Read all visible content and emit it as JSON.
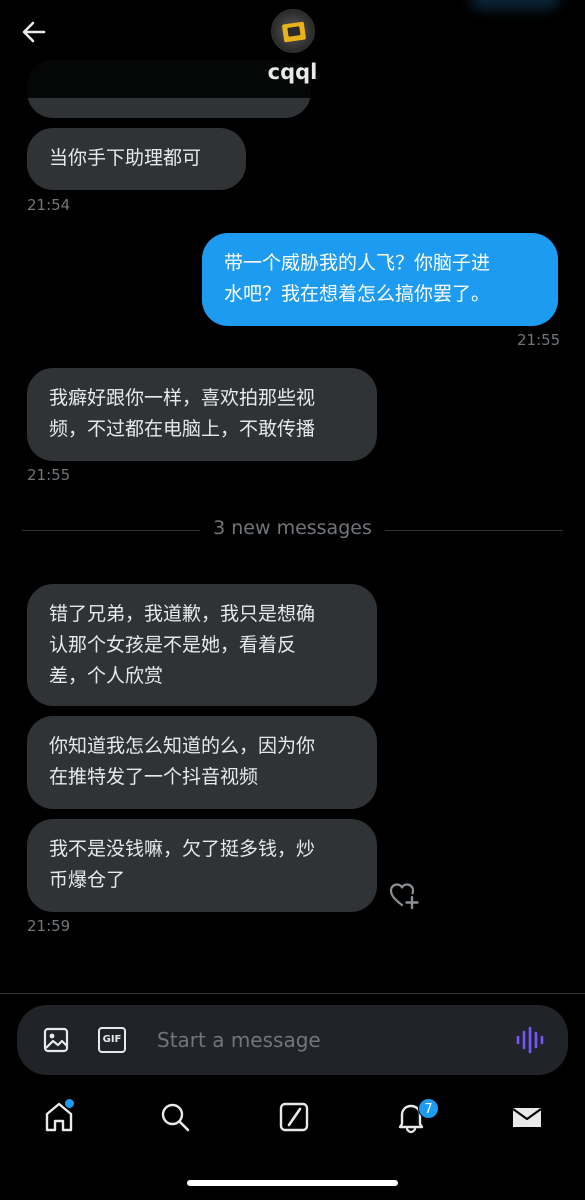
{
  "header": {
    "username": "cqql",
    "back_icon": "arrow-left-icon"
  },
  "messages": [
    {
      "direction": "in",
      "text": "当你手下助理都可",
      "time": "21:54"
    },
    {
      "direction": "out",
      "lines": [
        "带一个威胁我的人飞？你脑子进",
        "水吧？我在想着怎么搞你罢了。"
      ],
      "time": "21:55"
    },
    {
      "direction": "in",
      "lines": [
        "我癖好跟你一样，喜欢拍那些视",
        "频，不过都在电脑上，不敢传播"
      ],
      "time": "21:55"
    },
    {
      "direction": "in",
      "lines": [
        "错了兄弟，我道歉，我只是想确",
        "认那个女孩是不是她，看着反",
        "差，个人欣赏"
      ]
    },
    {
      "direction": "in",
      "lines": [
        "你知道我怎么知道的么，因为你",
        "在推特发了一个抖音视频"
      ]
    },
    {
      "direction": "in",
      "lines": [
        "我不是没钱嘛，欠了挺多钱，炒",
        "币爆仓了"
      ],
      "time": "21:59"
    }
  ],
  "divider": {
    "label": "3 new messages"
  },
  "composer": {
    "placeholder": "Start a message",
    "gif_label": "GIF",
    "image_icon": "image-icon",
    "voice_icon": "voice-waveform-icon"
  },
  "tabbar": {
    "items": [
      "home-icon",
      "search-icon",
      "grok-icon",
      "bell-icon",
      "mail-icon"
    ],
    "notification_count": "7"
  },
  "colors": {
    "background": "#000000",
    "incoming_bubble": "#2f3336",
    "outgoing_bubble": "#1d9bf0",
    "muted_text": "#71767b",
    "voice_accent": "#7856ff"
  }
}
